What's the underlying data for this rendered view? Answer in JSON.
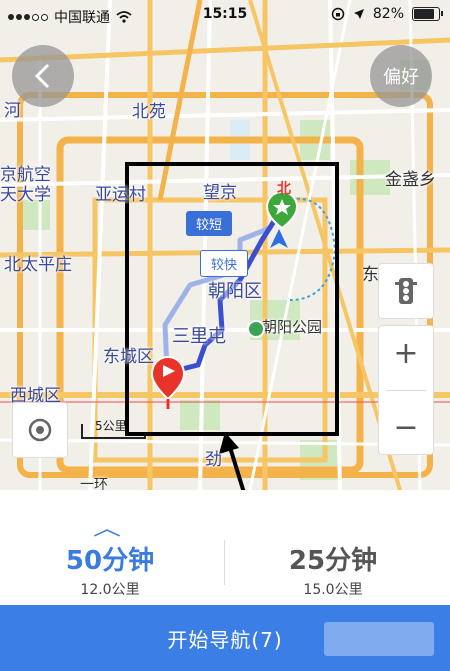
{
  "status_bar": {
    "carrier": "中国联通",
    "time": "15:15",
    "battery": "82%"
  },
  "map": {
    "back_icon": "chevron-left-icon",
    "preference_label": "偏好",
    "places": {
      "he": "河",
      "beiyuan": "北苑",
      "jingbei": "京航空",
      "tiandaxue": "天大学",
      "yayuncun": "亚运村",
      "wangjing": "望京",
      "jinzhanxiang": "金盏乡",
      "beitaipingzhuang": "北太平庄",
      "chaoyang": "朝阳区",
      "chaoyang_park": "朝阳公园",
      "sanlitun": "三里屯",
      "dongcheng": "东城区",
      "xicheng": "西城区",
      "jin": "劲",
      "dong": "东",
      "yihuan": "一环"
    },
    "route_tags": {
      "shorter": "较短",
      "faster": "较快"
    },
    "start_marker_label": "北",
    "scale_label": "5公里",
    "controls": {
      "traffic_icon": "traffic-light-icon",
      "zoom_in": "+",
      "zoom_out": "−",
      "locate_icon": "locate-icon"
    }
  },
  "routes": {
    "option1": {
      "time": "50分钟",
      "distance": "12.0公里",
      "color": "#3a7be0"
    },
    "option2": {
      "time": "25分钟",
      "distance": "15.0公里",
      "color": "#555555"
    }
  },
  "navigation": {
    "start_label": "开始导航(7)",
    "button_color": "#3b7fe6"
  }
}
